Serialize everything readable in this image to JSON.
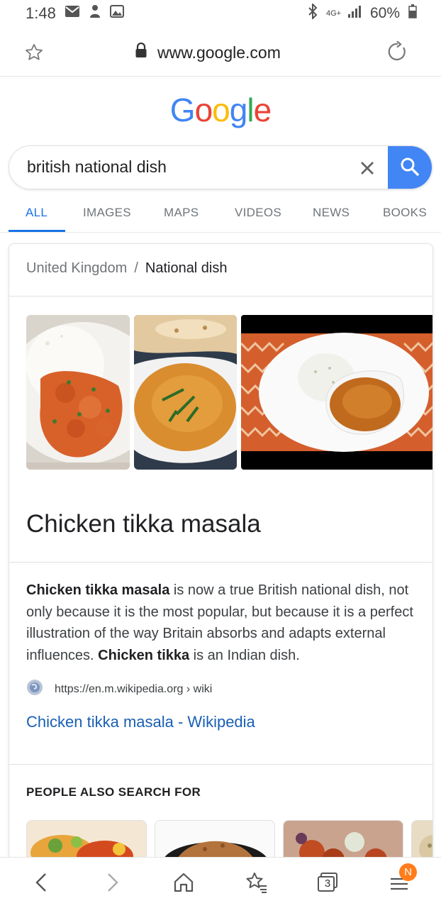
{
  "status_bar": {
    "time": "1:48",
    "network": "4G+",
    "battery": "60%"
  },
  "browser": {
    "url": "www.google.com"
  },
  "logo": {
    "letters": [
      "G",
      "o",
      "o",
      "g",
      "l",
      "e"
    ],
    "colors": [
      "#4285F4",
      "#EA4335",
      "#FBBC05",
      "#4285F4",
      "#34A853",
      "#EA4335"
    ]
  },
  "search": {
    "query": "british national dish"
  },
  "tabs": [
    {
      "label": "ALL",
      "active": true
    },
    {
      "label": "IMAGES"
    },
    {
      "label": "MAPS"
    },
    {
      "label": "VIDEOS"
    },
    {
      "label": "NEWS"
    },
    {
      "label": "BOOKS"
    }
  ],
  "card": {
    "breadcrumb_parent": "United Kingdom",
    "breadcrumb_sep": "/",
    "breadcrumb_current": "National dish",
    "title": "Chicken tikka masala",
    "desc_bold_1": "Chicken tikka masala",
    "desc_text_1": " is now a true British national dish, not only because it is the most popular, but because it is a perfect illustration of the way Britain absorbs and adapts external influences. ",
    "desc_bold_2": "Chicken tikka",
    "desc_text_2": " is an Indian dish.",
    "source_url": "https://en.m.wikipedia.org › wiki",
    "link_text": "Chicken tikka masala - Wikipedia",
    "people_also_search": "PEOPLE ALSO SEARCH FOR"
  },
  "bottom_nav": {
    "tab_count": "3",
    "badge": "N"
  }
}
